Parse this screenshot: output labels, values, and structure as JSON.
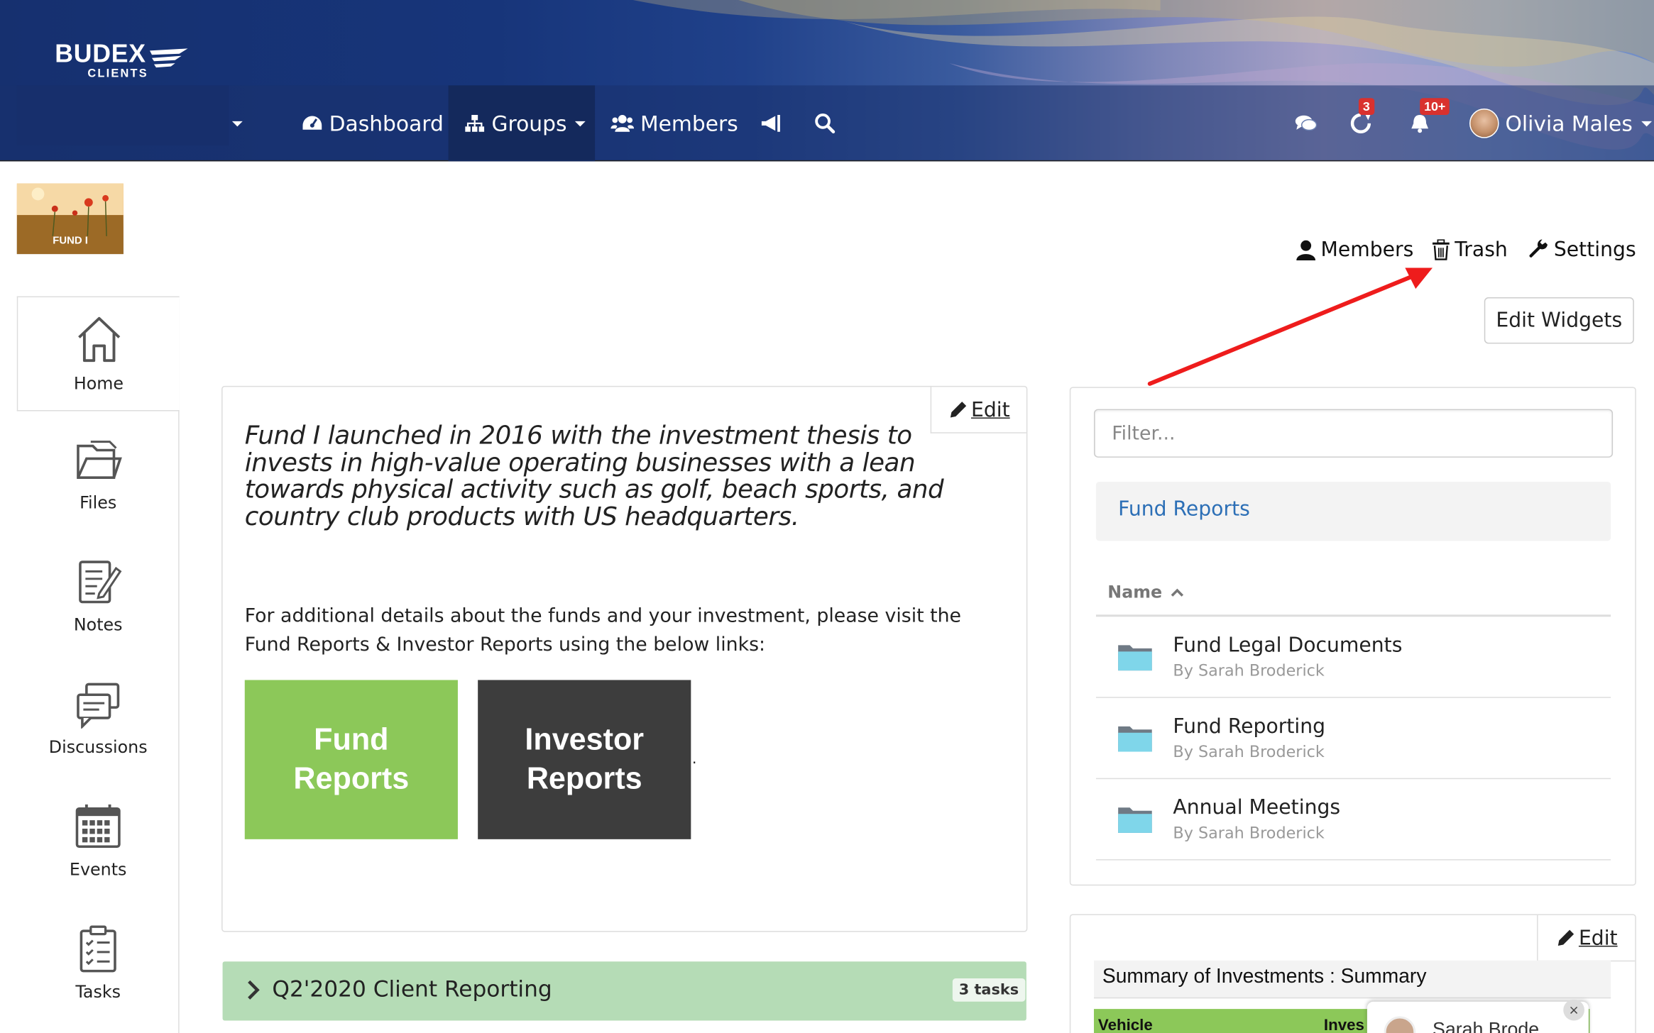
{
  "header": {
    "logo_main": "BUDEX",
    "logo_sub": "CLIENTS",
    "nav": {
      "dashboard": "Dashboard",
      "groups": "Groups",
      "members": "Members"
    },
    "icons": [
      "chat-icon",
      "refresh-icon",
      "bell-icon",
      "megaphone-icon",
      "search-icon"
    ],
    "badges": {
      "refresh": "3",
      "notifications": "10+"
    },
    "user_name": "Olivia Males"
  },
  "group": {
    "logo_label": "FUND I"
  },
  "top_actions": {
    "members": "Members",
    "trash": "Trash",
    "settings": "Settings",
    "edit_widgets": "Edit Widgets"
  },
  "sidebar": {
    "items": [
      {
        "label": "Home",
        "icon": "home-icon"
      },
      {
        "label": "Files",
        "icon": "files-icon"
      },
      {
        "label": "Notes",
        "icon": "notes-icon"
      },
      {
        "label": "Discussions",
        "icon": "discussions-icon"
      },
      {
        "label": "Events",
        "icon": "calendar-icon"
      },
      {
        "label": "Tasks",
        "icon": "tasks-icon"
      }
    ]
  },
  "intro_widget": {
    "edit_label": "Edit",
    "intro_text": "Fund I launched in 2016 with the investment thesis to invests in high-value operating businesses with a lean towards physical activity such as golf, beach sports, and country club products with US headquarters.",
    "details_text": "For additional details about the funds and your investment, please visit the Fund Reports & Investor Reports using the below links:",
    "tile_fund": "Fund Reports",
    "tile_investor": "Investor Reports",
    "trailing_dot": ".",
    "colors": {
      "fund_tile": "#8cc859",
      "investor_tile": "#3d3d3d"
    }
  },
  "task_list": {
    "title": "Q2'2020 Client Reporting",
    "count": "3 tasks"
  },
  "files_widget": {
    "filter_placeholder": "Filter...",
    "breadcrumb": "Fund Reports",
    "column_name": "Name",
    "rows": [
      {
        "name": "Fund Legal Documents",
        "by": "By Sarah Broderick"
      },
      {
        "name": "Fund Reporting",
        "by": "By Sarah Broderick"
      },
      {
        "name": "Annual Meetings",
        "by": "By Sarah Broderick"
      }
    ]
  },
  "summary_widget": {
    "edit_label": "Edit",
    "title": "Summary of Investments : Summary",
    "columns": [
      "Vehicle",
      "Inves"
    ]
  },
  "chat_popup": {
    "name": "Sarah Brode",
    "close": "×"
  }
}
